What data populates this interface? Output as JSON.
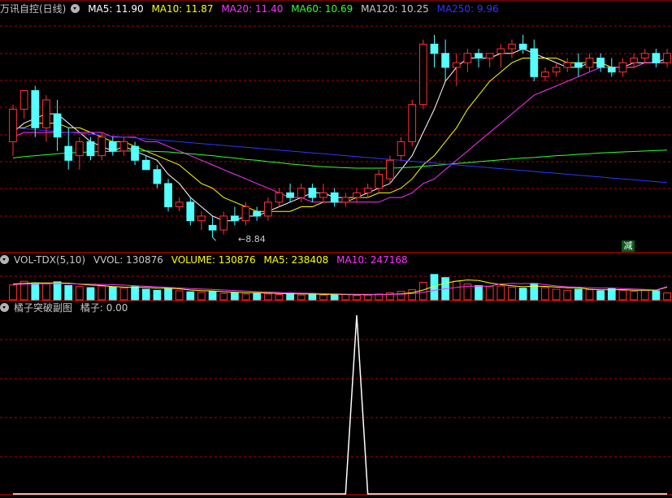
{
  "price_panel": {
    "title": "万讯自控(日线)",
    "indicators": [
      {
        "label": "MA5: 11.90",
        "color": "#ffffff"
      },
      {
        "label": "MA10: 11.87",
        "color": "#ffff00"
      },
      {
        "label": "MA20: 11.40",
        "color": "#ff33ff"
      },
      {
        "label": "MA60: 10.69",
        "color": "#33ff33"
      },
      {
        "label": "MA120: 10.25",
        "color": "#c8c8c8"
      },
      {
        "label": "MA250: 9.96",
        "color": "#3333ff"
      }
    ],
    "low_label": "8.84",
    "badge": "减"
  },
  "volume_panel": {
    "title": "VOL-TDX(5,10)",
    "indicators": [
      {
        "label": "VVOL: 130876",
        "color": "#c8c8c8"
      },
      {
        "label": "VOLUME: 130876",
        "color": "#ffff00"
      },
      {
        "label": "MA5: 238408",
        "color": "#ffff00"
      },
      {
        "label": "MA10: 247168",
        "color": "#ff33ff"
      }
    ]
  },
  "signal_panel": {
    "title": "橘子突破副图",
    "indicators": [
      {
        "label": "橘子: 0.00",
        "color": "#c8c8c8"
      }
    ]
  },
  "colors": {
    "up": "#ff3232",
    "down": "#54ffff",
    "grid": "#b00000",
    "ma5": "#ffffff",
    "ma10": "#ffff00",
    "ma20": "#ff33ff",
    "ma60": "#33ff33",
    "ma250": "#3333ff"
  },
  "chart_data": [
    {
      "type": "candlestick",
      "title": "万讯自控(日线)",
      "ylim": [
        8.6,
        13.6
      ],
      "low_marker": {
        "index": 18,
        "value": 8.84
      },
      "ohlc": [
        [
          10.9,
          11.7,
          10.6,
          11.6
        ],
        [
          11.6,
          12.0,
          11.4,
          12.0
        ],
        [
          12.0,
          12.1,
          11.0,
          11.2
        ],
        [
          11.2,
          11.9,
          10.9,
          11.8
        ],
        [
          11.5,
          11.8,
          10.7,
          11.0
        ],
        [
          10.8,
          11.2,
          10.3,
          10.5
        ],
        [
          10.6,
          11.0,
          10.3,
          10.9
        ],
        [
          10.9,
          11.0,
          10.5,
          10.6
        ],
        [
          10.6,
          11.1,
          10.5,
          11.0
        ],
        [
          10.9,
          11.0,
          10.6,
          10.7
        ],
        [
          10.7,
          11.0,
          10.6,
          10.9
        ],
        [
          10.8,
          10.9,
          10.4,
          10.5
        ],
        [
          10.5,
          10.6,
          10.3,
          10.3
        ],
        [
          10.3,
          10.4,
          9.9,
          10.0
        ],
        [
          10.0,
          10.1,
          9.4,
          9.5
        ],
        [
          9.5,
          9.7,
          9.4,
          9.6
        ],
        [
          9.6,
          9.7,
          9.1,
          9.2
        ],
        [
          9.2,
          9.4,
          9.0,
          9.3
        ],
        [
          9.1,
          9.3,
          8.84,
          9.0
        ],
        [
          9.0,
          9.4,
          8.9,
          9.3
        ],
        [
          9.3,
          9.5,
          9.1,
          9.2
        ],
        [
          9.2,
          9.6,
          9.1,
          9.5
        ],
        [
          9.4,
          9.5,
          9.2,
          9.3
        ],
        [
          9.3,
          9.7,
          9.2,
          9.6
        ],
        [
          9.6,
          9.9,
          9.5,
          9.8
        ],
        [
          9.8,
          10.0,
          9.6,
          9.7
        ],
        [
          9.7,
          10.0,
          9.6,
          9.9
        ],
        [
          9.9,
          10.0,
          9.6,
          9.7
        ],
        [
          9.7,
          10.0,
          9.6,
          9.8
        ],
        [
          9.8,
          9.9,
          9.5,
          9.6
        ],
        [
          9.6,
          9.8,
          9.5,
          9.7
        ],
        [
          9.7,
          9.9,
          9.6,
          9.8
        ],
        [
          9.8,
          10.0,
          9.7,
          9.9
        ],
        [
          9.9,
          10.3,
          9.8,
          10.2
        ],
        [
          10.1,
          10.6,
          10.0,
          10.5
        ],
        [
          10.6,
          11.0,
          10.5,
          10.9
        ],
        [
          10.9,
          11.8,
          10.8,
          11.7
        ],
        [
          11.7,
          13.1,
          11.6,
          13.0
        ],
        [
          13.0,
          13.2,
          12.5,
          12.8
        ],
        [
          12.8,
          13.1,
          12.2,
          12.5
        ],
        [
          12.5,
          12.8,
          12.1,
          12.6
        ],
        [
          12.6,
          12.9,
          12.4,
          12.8
        ],
        [
          12.8,
          12.9,
          12.5,
          12.7
        ],
        [
          12.7,
          12.8,
          12.5,
          12.8
        ],
        [
          12.8,
          13.0,
          12.5,
          12.9
        ],
        [
          12.9,
          13.1,
          12.7,
          13.0
        ],
        [
          13.0,
          13.2,
          12.8,
          12.9
        ],
        [
          12.9,
          13.1,
          12.2,
          12.3
        ],
        [
          12.3,
          12.5,
          12.2,
          12.4
        ],
        [
          12.4,
          12.6,
          12.3,
          12.5
        ],
        [
          12.5,
          12.7,
          12.4,
          12.6
        ],
        [
          12.6,
          12.8,
          12.3,
          12.5
        ],
        [
          12.5,
          12.8,
          12.4,
          12.7
        ],
        [
          12.7,
          12.8,
          12.4,
          12.5
        ],
        [
          12.5,
          12.7,
          12.3,
          12.4
        ],
        [
          12.4,
          12.7,
          12.3,
          12.6
        ],
        [
          12.6,
          12.8,
          12.5,
          12.7
        ],
        [
          12.7,
          12.9,
          12.6,
          12.8
        ],
        [
          12.8,
          12.9,
          12.5,
          12.6
        ],
        [
          12.6,
          12.9,
          12.5,
          12.8
        ]
      ],
      "series": [
        {
          "name": "MA5",
          "values": [
            11.1,
            11.3,
            11.4,
            11.5,
            11.5,
            11.3,
            11.1,
            10.9,
            10.8,
            10.7,
            10.8,
            10.7,
            10.6,
            10.5,
            10.2,
            10.0,
            9.7,
            9.5,
            9.3,
            9.2,
            9.2,
            9.3,
            9.3,
            9.4,
            9.5,
            9.6,
            9.7,
            9.8,
            9.8,
            9.7,
            9.7,
            9.7,
            9.8,
            9.9,
            10.0,
            10.3,
            10.6,
            11.1,
            11.6,
            12.2,
            12.5,
            12.7,
            12.7,
            12.7,
            12.8,
            12.8,
            12.9,
            12.8,
            12.7,
            12.6,
            12.5,
            12.5,
            12.6,
            12.6,
            12.5,
            12.5,
            12.6,
            12.6,
            12.6,
            12.7
          ]
        },
        {
          "name": "MA10",
          "values": [
            11.2,
            11.2,
            11.3,
            11.3,
            11.3,
            11.2,
            11.2,
            11.1,
            11.0,
            10.9,
            10.9,
            10.8,
            10.7,
            10.6,
            10.5,
            10.4,
            10.2,
            10.0,
            9.9,
            9.7,
            9.6,
            9.5,
            9.4,
            9.4,
            9.4,
            9.4,
            9.5,
            9.5,
            9.6,
            9.6,
            9.6,
            9.7,
            9.7,
            9.8,
            9.8,
            9.9,
            10.1,
            10.4,
            10.6,
            10.9,
            11.2,
            11.6,
            11.9,
            12.2,
            12.4,
            12.6,
            12.7,
            12.7,
            12.7,
            12.7,
            12.6,
            12.6,
            12.6,
            12.6,
            12.5,
            12.5,
            12.5,
            12.6,
            12.6,
            12.6
          ]
        },
        {
          "name": "MA20",
          "values": [
            11.0,
            11.1,
            11.1,
            11.1,
            11.1,
            11.1,
            11.1,
            11.1,
            11.1,
            11.0,
            11.0,
            11.0,
            10.9,
            10.9,
            10.8,
            10.7,
            10.6,
            10.5,
            10.4,
            10.3,
            10.2,
            10.1,
            10.0,
            9.9,
            9.8,
            9.7,
            9.7,
            9.6,
            9.6,
            9.6,
            9.6,
            9.6,
            9.6,
            9.6,
            9.7,
            9.7,
            9.8,
            10.0,
            10.1,
            10.3,
            10.5,
            10.7,
            10.9,
            11.1,
            11.3,
            11.5,
            11.7,
            11.9,
            12.0,
            12.1,
            12.2,
            12.3,
            12.4,
            12.5,
            12.5,
            12.5,
            12.5,
            12.6,
            12.6,
            12.6
          ]
        },
        {
          "name": "MA60",
          "values": [
            10.55,
            10.58,
            10.6,
            10.62,
            10.64,
            10.66,
            10.67,
            10.68,
            10.69,
            10.69,
            10.7,
            10.7,
            10.7,
            10.69,
            10.68,
            10.66,
            10.64,
            10.62,
            10.6,
            10.57,
            10.55,
            10.52,
            10.5,
            10.47,
            10.45,
            10.42,
            10.4,
            10.38,
            10.36,
            10.35,
            10.34,
            10.33,
            10.33,
            10.33,
            10.33,
            10.34,
            10.35,
            10.37,
            10.39,
            10.41,
            10.43,
            10.45,
            10.47,
            10.49,
            10.51,
            10.53,
            10.55,
            10.56,
            10.58,
            10.6,
            10.61,
            10.63,
            10.64,
            10.66,
            10.67,
            10.68,
            10.69,
            10.7,
            10.71,
            10.72
          ]
        },
        {
          "name": "MA250",
          "values": [
            11.2,
            11.18,
            11.16,
            11.14,
            11.12,
            11.1,
            11.08,
            11.06,
            11.04,
            11.02,
            11.0,
            10.98,
            10.96,
            10.94,
            10.92,
            10.9,
            10.88,
            10.86,
            10.84,
            10.82,
            10.8,
            10.78,
            10.76,
            10.74,
            10.72,
            10.7,
            10.68,
            10.66,
            10.64,
            10.62,
            10.6,
            10.58,
            10.56,
            10.54,
            10.52,
            10.5,
            10.48,
            10.46,
            10.44,
            10.42,
            10.4,
            10.38,
            10.36,
            10.34,
            10.32,
            10.3,
            10.28,
            10.26,
            10.24,
            10.22,
            10.2,
            10.18,
            10.16,
            10.14,
            10.12,
            10.1,
            10.08,
            10.06,
            10.04,
            10.02
          ]
        }
      ]
    },
    {
      "type": "bar",
      "title": "VOL-TDX(5,10)",
      "ylim": [
        0,
        600000
      ],
      "volumes": [
        280000,
        350000,
        320000,
        300000,
        340000,
        270000,
        250000,
        230000,
        260000,
        240000,
        220000,
        250000,
        200000,
        180000,
        220000,
        170000,
        150000,
        140000,
        160000,
        120000,
        130000,
        110000,
        120000,
        110000,
        100000,
        130000,
        90000,
        100000,
        90000,
        110000,
        100000,
        80000,
        90000,
        110000,
        130000,
        160000,
        190000,
        330000,
        480000,
        420000,
        350000,
        300000,
        270000,
        250000,
        260000,
        240000,
        220000,
        310000,
        230000,
        200000,
        180000,
        200000,
        190000,
        170000,
        210000,
        180000,
        160000,
        190000,
        170000,
        130876
      ],
      "series": [
        {
          "name": "MA5",
          "values": [
            300000,
            310000,
            320000,
            318000,
            318000,
            316000,
            296000,
            278000,
            270000,
            250000,
            240000,
            236000,
            234000,
            222000,
            218000,
            208000,
            184000,
            172000,
            168000,
            152000,
            144000,
            136000,
            136000,
            128000,
            118000,
            114000,
            112000,
            110000,
            102000,
            104000,
            98000,
            96000,
            96000,
            98000,
            102000,
            114000,
            136000,
            184000,
            258000,
            316000,
            354000,
            376000,
            364000,
            318000,
            286000,
            264000,
            248000,
            258000,
            254000,
            240000,
            228000,
            228000,
            200000,
            188000,
            190000,
            190000,
            182000,
            182000,
            182000,
            238408
          ]
        },
        {
          "name": "MA10",
          "values": [
            290000,
            295000,
            300000,
            305000,
            310000,
            305000,
            300000,
            295000,
            290000,
            285000,
            278000,
            266000,
            256000,
            246000,
            234000,
            224000,
            212000,
            203000,
            195000,
            185000,
            176000,
            164000,
            154000,
            148000,
            138000,
            129000,
            124000,
            123000,
            115000,
            111000,
            106000,
            104000,
            104000,
            100000,
            103000,
            106000,
            117000,
            140000,
            178000,
            208000,
            234000,
            256000,
            260000,
            256000,
            301000,
            309000,
            306000,
            311000,
            286000,
            263000,
            246000,
            238000,
            229000,
            221000,
            225000,
            210000,
            205000,
            195000,
            186000,
            247168
          ]
        }
      ]
    },
    {
      "type": "line",
      "title": "橘子突破副图",
      "ylim": [
        0,
        1
      ],
      "series": [
        {
          "name": "橘子",
          "values": [
            0,
            0,
            0,
            0,
            0,
            0,
            0,
            0,
            0,
            0,
            0,
            0,
            0,
            0,
            0,
            0,
            0,
            0,
            0,
            0,
            0,
            0,
            0,
            0,
            0,
            0,
            0,
            0,
            0,
            0,
            0,
            1,
            0,
            0,
            0,
            0,
            0,
            0,
            0,
            0,
            0,
            0,
            0,
            0,
            0,
            0,
            0,
            0,
            0,
            0,
            0,
            0,
            0,
            0,
            0,
            0,
            0,
            0,
            0,
            0
          ]
        }
      ]
    }
  ]
}
